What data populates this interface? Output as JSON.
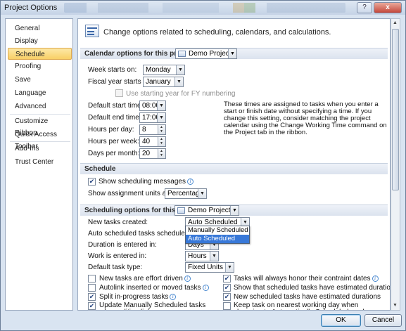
{
  "window": {
    "title": "Project Options",
    "help_label": "?",
    "close_label": "x"
  },
  "sidebar": {
    "items": [
      {
        "label": "General"
      },
      {
        "label": "Display"
      },
      {
        "label": "Schedule"
      },
      {
        "label": "Proofing"
      },
      {
        "label": "Save"
      },
      {
        "label": "Language"
      },
      {
        "label": "Advanced"
      },
      {
        "label": "Customize Ribbon"
      },
      {
        "label": "Quick Access Toolbar"
      },
      {
        "label": "Add-Ins"
      },
      {
        "label": "Trust Center"
      }
    ],
    "selected": "Schedule"
  },
  "header": {
    "text": "Change options related to scheduling, calendars, and calculations."
  },
  "calendar": {
    "section_title": "Calendar options for this project:",
    "project": "Demo Project",
    "week_starts_label": "Week starts on:",
    "week_starts_value": "Monday",
    "fiscal_label": "Fiscal year starts in:",
    "fiscal_value": "January",
    "fy_numbering_label": "Use starting year for FY numbering",
    "start_time_label": "Default start time:",
    "start_time_value": "08:00",
    "end_time_label": "Default end time:",
    "end_time_value": "17:00",
    "hours_day_label": "Hours per day:",
    "hours_day_value": "8",
    "hours_week_label": "Hours per week:",
    "hours_week_value": "40",
    "days_month_label": "Days per month:",
    "days_month_value": "20",
    "note": "These times are assigned to tasks when you enter a start or finish date without specifying a time. If you change this setting, consider matching the project calendar using the Change Working Time command on the Project tab in the ribbon."
  },
  "schedule": {
    "section_title": "Schedule",
    "show_messages_label": "Show scheduling messages",
    "show_messages_checked": true,
    "assignment_units_label": "Show assignment units as a:",
    "assignment_units_value": "Percentage"
  },
  "scheduling_options": {
    "section_title": "Scheduling options for this project:",
    "project": "Demo Project",
    "new_tasks_label": "New tasks created:",
    "new_tasks_value": "Auto Scheduled",
    "dropdown_options": [
      "Manually Scheduled",
      "Auto Scheduled"
    ],
    "highlighted_option": "Auto Scheduled",
    "auto_scheduled_on_label": "Auto scheduled tasks scheduled on:",
    "duration_label": "Duration is entered in:",
    "duration_value": "Days",
    "work_label": "Work is entered in:",
    "work_value": "Hours",
    "task_type_label": "Default task type:",
    "task_type_value": "Fixed Units",
    "checks": [
      {
        "label": "New tasks are effort driven",
        "checked": false,
        "info": true
      },
      {
        "label": "Tasks will always honor their contraint dates",
        "checked": true,
        "info": true
      },
      {
        "label": "Autolink inserted or moved tasks",
        "checked": false,
        "info": true
      },
      {
        "label": "Show that scheduled tasks have estimated durations",
        "checked": true,
        "info": true
      },
      {
        "label": "Split in-progress tasks",
        "checked": true,
        "info": true
      },
      {
        "label": "New scheduled tasks have estimated durations",
        "checked": true,
        "info": false
      },
      {
        "label": "Update Manually Scheduled tasks when editing links",
        "checked": true,
        "info": false
      },
      {
        "label": "Keep task on nearest working day when changing to Automatically Scheduled mode",
        "checked": false,
        "info": false
      }
    ]
  },
  "footer": {
    "ok_label": "OK",
    "cancel_label": "Cancel"
  }
}
